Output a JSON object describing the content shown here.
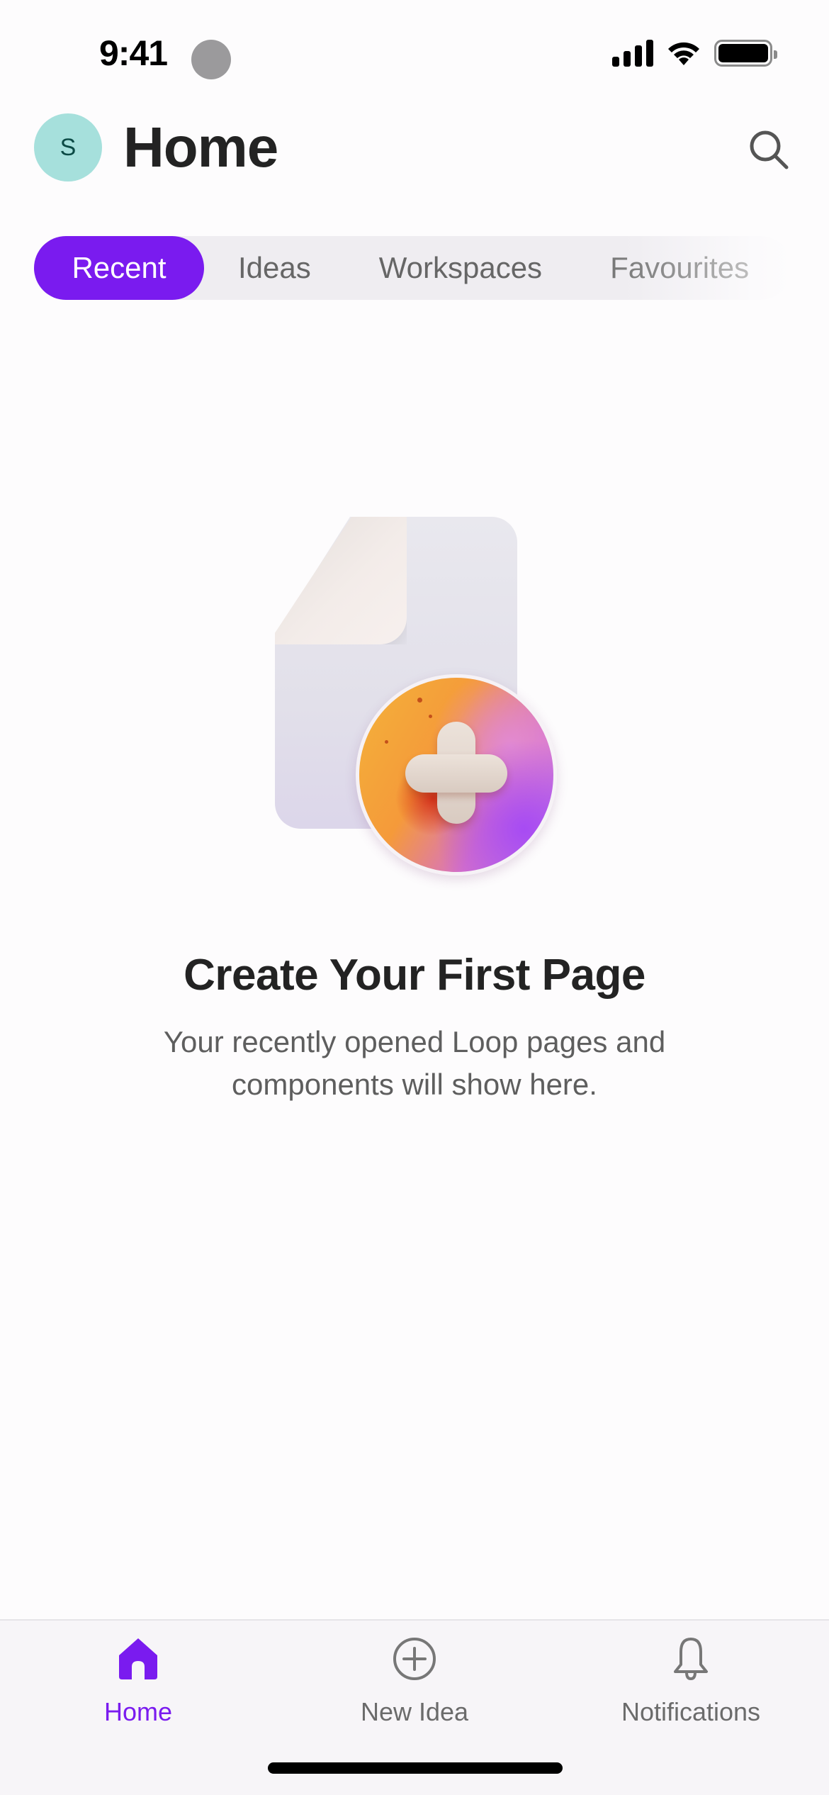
{
  "status_bar": {
    "time": "9:41",
    "icons": [
      "signal-icon",
      "wifi-icon",
      "battery-icon"
    ]
  },
  "header": {
    "avatar_initial": "S",
    "title": "Home",
    "search_icon": "search-icon"
  },
  "tabs": [
    {
      "label": "Recent",
      "active": true
    },
    {
      "label": "Ideas",
      "active": false
    },
    {
      "label": "Workspaces",
      "active": false
    },
    {
      "label": "Favourites",
      "active": false
    }
  ],
  "empty_state": {
    "illustration": "new-page-illustration",
    "title": "Create Your First Page",
    "description": "Your recently opened Loop pages and components will show here."
  },
  "bottom_nav": [
    {
      "label": "Home",
      "icon": "home-icon",
      "active": true
    },
    {
      "label": "New Idea",
      "icon": "add-circle-icon",
      "active": false
    },
    {
      "label": "Notifications",
      "icon": "bell-icon",
      "active": false
    }
  ],
  "colors": {
    "accent": "#7a1bef",
    "avatar_bg": "#a6e0dc",
    "avatar_text": "#0b4a45",
    "inactive_text": "#666666",
    "tab_track": "#efedf1"
  }
}
